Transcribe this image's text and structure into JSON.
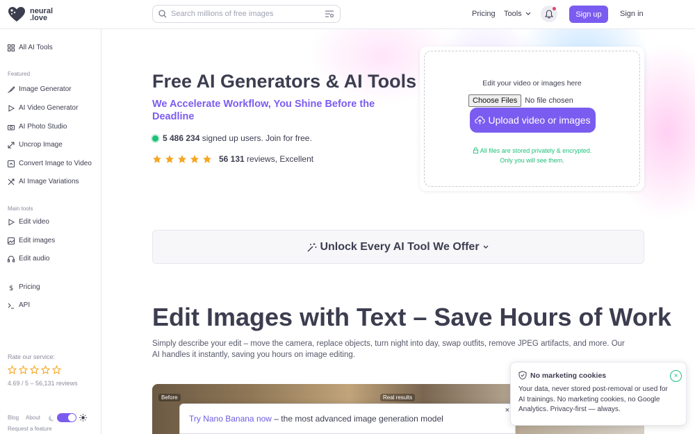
{
  "header": {
    "logo_line1": "neural",
    "logo_line2": ".love",
    "search_placeholder": "Search millions of free images",
    "nav_pricing": "Pricing",
    "nav_tools": "Tools",
    "signup": "Sign up",
    "signin": "Sign in"
  },
  "sidebar": {
    "all_tools": "All AI Tools",
    "featured_label": "Featured",
    "featured": [
      {
        "label": "Image Generator",
        "icon": "brush-icon"
      },
      {
        "label": "AI Video Generator",
        "icon": "play-icon"
      },
      {
        "label": "AI Photo Studio",
        "icon": "camera-icon"
      },
      {
        "label": "Uncrop Image",
        "icon": "expand-icon"
      },
      {
        "label": "Convert Image to Video",
        "icon": "convert-icon"
      },
      {
        "label": "AI Image Variations",
        "icon": "shuffle-icon"
      }
    ],
    "main_label": "Main tools",
    "main": [
      {
        "label": "Edit video",
        "icon": "play-icon"
      },
      {
        "label": "Edit images",
        "icon": "image-icon"
      },
      {
        "label": "Edit audio",
        "icon": "headphones-icon"
      }
    ],
    "pricing": "Pricing",
    "api": "API",
    "rate_label": "Rate our service:",
    "rate_score": "4.69 / 5 – 56,131 reviews",
    "blog": "Blog",
    "about": "About",
    "request": "Request a feature"
  },
  "hero": {
    "title": "Free AI Generators & AI Tools",
    "subtitle": "We Accelerate Workflow, You Shine Before the Deadline",
    "users_count": "5 486 234",
    "users_text": " signed up users. Join for free.",
    "reviews_count": "56 131",
    "reviews_text": " reviews, Excellent",
    "rating": 5
  },
  "upload": {
    "hint": "Edit your video or images here",
    "choose_files": "Choose Files",
    "no_file": "No file chosen",
    "button": "Upload video or images",
    "privacy_line1": "All files are stored privately & encrypted.",
    "privacy_line2": "Only you will see them."
  },
  "unlock": {
    "label": "Unlock Every AI Tool We Offer"
  },
  "section": {
    "title": "Edit Images with Text – Save Hours of Work",
    "description": "Simply describe your edit – move the camera, replace objects, turn night into day, swap outfits, remove JPEG artifacts, and more. Our AI handles it instantly, saving you hours on image editing.",
    "before_label": "Before",
    "after_label": "Real results"
  },
  "banner": {
    "link": "Try Nano Banana now",
    "text": " – the most advanced image generation model",
    "close": "×"
  },
  "cookie": {
    "title": "No marketing cookies",
    "body": "Your data, never stored post-removal or used for AI trainings. No marketing cookies, no Google Analytics. Privacy-first — always.",
    "close": "×"
  },
  "colors": {
    "accent": "#7b5cf0",
    "green": "#1ec07b",
    "text": "#3c3d4f",
    "star": "#f5a623"
  }
}
